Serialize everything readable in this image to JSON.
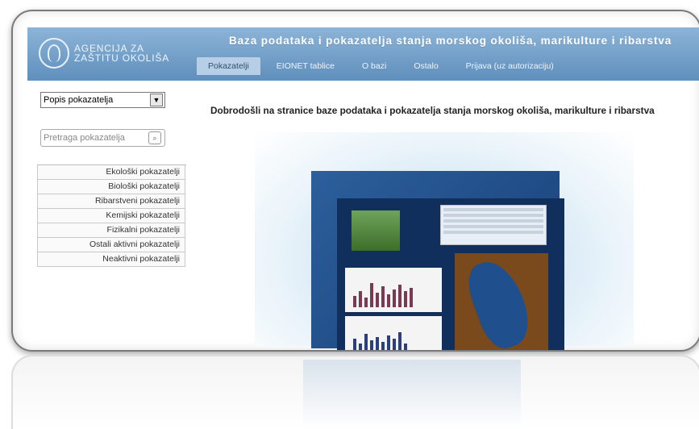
{
  "logo": {
    "line1": "AGENCIJA ZA",
    "line2": "ZAŠTITU OKOLIŠA"
  },
  "site_title": "Baza podataka i pokazatelja stanja morskog okoliša, marikulture i ribarstva",
  "nav": {
    "tabs": [
      "Pokazatelji",
      "EIONET tablice",
      "O bazi",
      "Ostalo",
      "Prijava (uz autorizaciju)"
    ],
    "active_index": 0
  },
  "sidebar": {
    "select_value": "Popis pokazatelja",
    "search_placeholder": "Pretraga pokazatelja",
    "menu": [
      "Ekološki pokazatelji",
      "Biološki pokazatelji",
      "Ribarstveni pokazatelji",
      "Kemijski pokazatelji",
      "Fizikalni pokazatelji",
      "Ostali aktivni pokazatelji",
      "Neaktivni pokazatelji"
    ]
  },
  "welcome_text": "Dobrodošli na stranice baze podataka i pokazatelja stanja morskog okoliša, marikulture i ribarstva",
  "colors": {
    "header_top": "#8db4d7",
    "header_bottom": "#5f8fbd",
    "active_tab": "#b6cfe6"
  },
  "icons": {
    "select": "chevron-down-icon",
    "search": "search-icon"
  }
}
